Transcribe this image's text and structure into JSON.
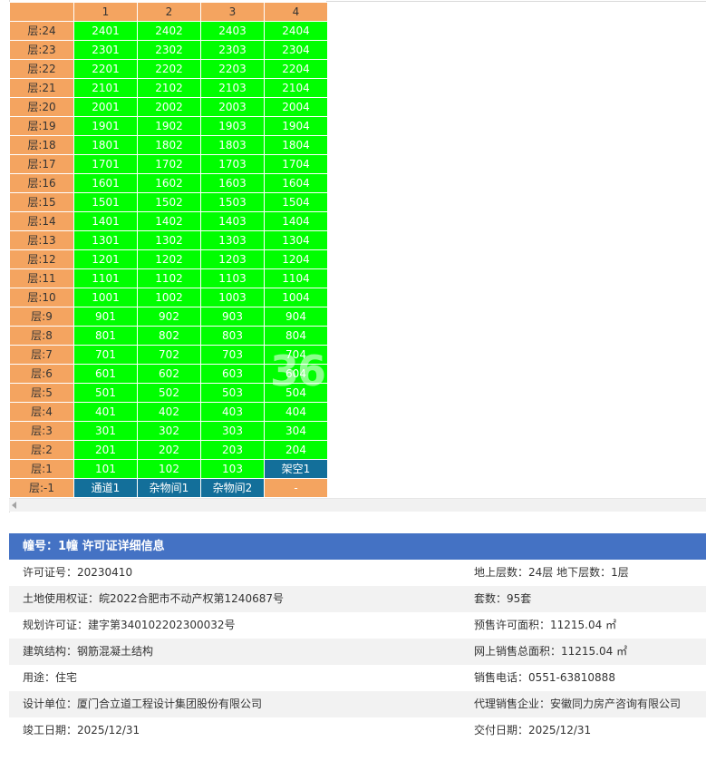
{
  "grid": {
    "columns": [
      "1",
      "2",
      "3",
      "4"
    ],
    "floor_prefix": "层:",
    "rows": [
      {
        "floor": "24",
        "units": [
          {
            "label": "2401",
            "status": "green"
          },
          {
            "label": "2402",
            "status": "green"
          },
          {
            "label": "2403",
            "status": "green"
          },
          {
            "label": "2404",
            "status": "green"
          }
        ]
      },
      {
        "floor": "23",
        "units": [
          {
            "label": "2301",
            "status": "green"
          },
          {
            "label": "2302",
            "status": "green"
          },
          {
            "label": "2303",
            "status": "green"
          },
          {
            "label": "2304",
            "status": "green"
          }
        ]
      },
      {
        "floor": "22",
        "units": [
          {
            "label": "2201",
            "status": "green"
          },
          {
            "label": "2202",
            "status": "green"
          },
          {
            "label": "2203",
            "status": "green"
          },
          {
            "label": "2204",
            "status": "green"
          }
        ]
      },
      {
        "floor": "21",
        "units": [
          {
            "label": "2101",
            "status": "green"
          },
          {
            "label": "2102",
            "status": "green"
          },
          {
            "label": "2103",
            "status": "green"
          },
          {
            "label": "2104",
            "status": "green"
          }
        ]
      },
      {
        "floor": "20",
        "units": [
          {
            "label": "2001",
            "status": "green"
          },
          {
            "label": "2002",
            "status": "green"
          },
          {
            "label": "2003",
            "status": "green"
          },
          {
            "label": "2004",
            "status": "green"
          }
        ]
      },
      {
        "floor": "19",
        "units": [
          {
            "label": "1901",
            "status": "green"
          },
          {
            "label": "1902",
            "status": "green"
          },
          {
            "label": "1903",
            "status": "green"
          },
          {
            "label": "1904",
            "status": "green"
          }
        ]
      },
      {
        "floor": "18",
        "units": [
          {
            "label": "1801",
            "status": "green"
          },
          {
            "label": "1802",
            "status": "green"
          },
          {
            "label": "1803",
            "status": "green"
          },
          {
            "label": "1804",
            "status": "green"
          }
        ]
      },
      {
        "floor": "17",
        "units": [
          {
            "label": "1701",
            "status": "green"
          },
          {
            "label": "1702",
            "status": "green"
          },
          {
            "label": "1703",
            "status": "green"
          },
          {
            "label": "1704",
            "status": "green"
          }
        ]
      },
      {
        "floor": "16",
        "units": [
          {
            "label": "1601",
            "status": "green"
          },
          {
            "label": "1602",
            "status": "green"
          },
          {
            "label": "1603",
            "status": "green"
          },
          {
            "label": "1604",
            "status": "green"
          }
        ]
      },
      {
        "floor": "15",
        "units": [
          {
            "label": "1501",
            "status": "green"
          },
          {
            "label": "1502",
            "status": "green"
          },
          {
            "label": "1503",
            "status": "green"
          },
          {
            "label": "1504",
            "status": "green"
          }
        ]
      },
      {
        "floor": "14",
        "units": [
          {
            "label": "1401",
            "status": "green"
          },
          {
            "label": "1402",
            "status": "green"
          },
          {
            "label": "1403",
            "status": "green"
          },
          {
            "label": "1404",
            "status": "green"
          }
        ]
      },
      {
        "floor": "13",
        "units": [
          {
            "label": "1301",
            "status": "green"
          },
          {
            "label": "1302",
            "status": "green"
          },
          {
            "label": "1303",
            "status": "green"
          },
          {
            "label": "1304",
            "status": "green"
          }
        ]
      },
      {
        "floor": "12",
        "units": [
          {
            "label": "1201",
            "status": "green"
          },
          {
            "label": "1202",
            "status": "green"
          },
          {
            "label": "1203",
            "status": "green"
          },
          {
            "label": "1204",
            "status": "green"
          }
        ]
      },
      {
        "floor": "11",
        "units": [
          {
            "label": "1101",
            "status": "green"
          },
          {
            "label": "1102",
            "status": "green"
          },
          {
            "label": "1103",
            "status": "green"
          },
          {
            "label": "1104",
            "status": "green"
          }
        ]
      },
      {
        "floor": "10",
        "units": [
          {
            "label": "1001",
            "status": "green"
          },
          {
            "label": "1002",
            "status": "green"
          },
          {
            "label": "1003",
            "status": "green"
          },
          {
            "label": "1004",
            "status": "green"
          }
        ]
      },
      {
        "floor": "9",
        "units": [
          {
            "label": "901",
            "status": "green"
          },
          {
            "label": "902",
            "status": "green"
          },
          {
            "label": "903",
            "status": "green"
          },
          {
            "label": "904",
            "status": "green"
          }
        ]
      },
      {
        "floor": "8",
        "units": [
          {
            "label": "801",
            "status": "green"
          },
          {
            "label": "802",
            "status": "green"
          },
          {
            "label": "803",
            "status": "green"
          },
          {
            "label": "804",
            "status": "green"
          }
        ]
      },
      {
        "floor": "7",
        "units": [
          {
            "label": "701",
            "status": "green"
          },
          {
            "label": "702",
            "status": "green"
          },
          {
            "label": "703",
            "status": "green"
          },
          {
            "label": "704",
            "status": "green"
          }
        ]
      },
      {
        "floor": "6",
        "units": [
          {
            "label": "601",
            "status": "green"
          },
          {
            "label": "602",
            "status": "green"
          },
          {
            "label": "603",
            "status": "green"
          },
          {
            "label": "604",
            "status": "green"
          }
        ]
      },
      {
        "floor": "5",
        "units": [
          {
            "label": "501",
            "status": "green"
          },
          {
            "label": "502",
            "status": "green"
          },
          {
            "label": "503",
            "status": "green"
          },
          {
            "label": "504",
            "status": "green"
          }
        ]
      },
      {
        "floor": "4",
        "units": [
          {
            "label": "401",
            "status": "green"
          },
          {
            "label": "402",
            "status": "green"
          },
          {
            "label": "403",
            "status": "green"
          },
          {
            "label": "404",
            "status": "green"
          }
        ]
      },
      {
        "floor": "3",
        "units": [
          {
            "label": "301",
            "status": "green"
          },
          {
            "label": "302",
            "status": "green"
          },
          {
            "label": "303",
            "status": "green"
          },
          {
            "label": "304",
            "status": "green"
          }
        ]
      },
      {
        "floor": "2",
        "units": [
          {
            "label": "201",
            "status": "green"
          },
          {
            "label": "202",
            "status": "green"
          },
          {
            "label": "203",
            "status": "green"
          },
          {
            "label": "204",
            "status": "green"
          }
        ]
      },
      {
        "floor": "1",
        "units": [
          {
            "label": "101",
            "status": "green"
          },
          {
            "label": "102",
            "status": "green"
          },
          {
            "label": "103",
            "status": "green"
          },
          {
            "label": "架空1",
            "status": "blue"
          }
        ]
      },
      {
        "floor": "-1",
        "units": [
          {
            "label": "通道1",
            "status": "blue"
          },
          {
            "label": "杂物间1",
            "status": "blue"
          },
          {
            "label": "杂物间2",
            "status": "blue"
          },
          {
            "label": "-",
            "status": "orange"
          }
        ]
      }
    ]
  },
  "watermark": "365",
  "colors": {
    "available_green": "#00ff00",
    "other_blue": "#136f9a",
    "header_orange": "#f4a460",
    "panel_title_blue": "#4472c4"
  },
  "detail": {
    "title": "幢号：1幢 许可证详细信息",
    "rows": [
      {
        "left": "许可证号：20230410",
        "right": "地上层数：24层  地下层数：1层"
      },
      {
        "left": "土地使用权证：皖2022合肥市不动产权第1240687号",
        "right": "套数：95套"
      },
      {
        "left": "规划许可证：建字第340102202300032号",
        "right": "预售许可面积：11215.04 ㎡"
      },
      {
        "left": "建筑结构：钢筋混凝土结构",
        "right": "网上销售总面积：11215.04 ㎡"
      },
      {
        "left": "用途：住宅",
        "right": "销售电话：0551-63810888"
      },
      {
        "left": "设计单位：厦门合立道工程设计集团股份有限公司",
        "right": "代理销售企业：安徽同力房产咨询有限公司"
      },
      {
        "left": "竣工日期：2025/12/31",
        "right": "交付日期：2025/12/31"
      }
    ]
  }
}
